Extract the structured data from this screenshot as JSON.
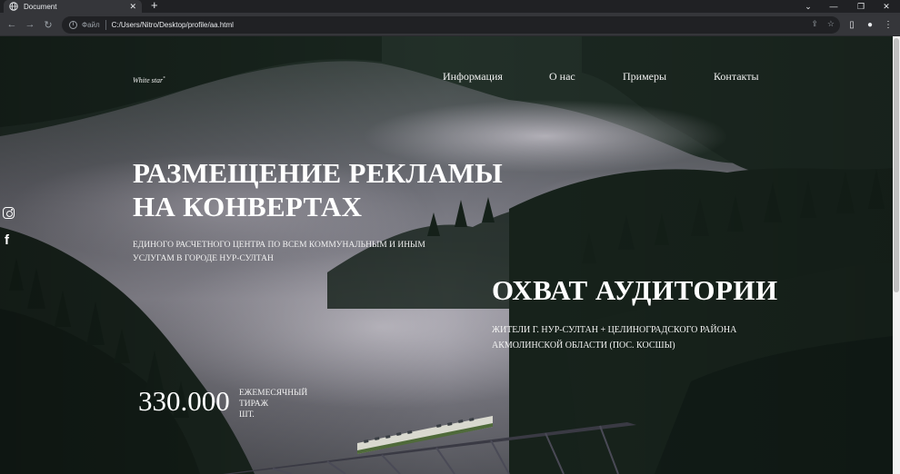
{
  "browser": {
    "tab_title": "Document",
    "url_scheme_label": "Файл",
    "url": "C:/Users/Nitro/Desktop/profile/aa.html"
  },
  "site": {
    "logo": "White star",
    "logo_mark": "*",
    "nav": [
      "Информация",
      "О нас",
      "Примеры",
      "Контакты"
    ],
    "headline_line1": "РАЗМЕЩЕНИЕ РЕКЛАМЫ",
    "headline_line2": "НА КОНВЕРТАХ",
    "sub_line1": "ЕДИНОГО РАСЧЕТНОГО ЦЕНТРА ПО ВСЕМ КОММУНАЛЬНЫМ И ИНЫМ",
    "sub_line2": "УСЛУГАМ В ГОРОДЕ НУР-СУЛТАН",
    "reach_title": "ОХВАТ АУДИТОРИИ",
    "reach_line1": "ЖИТЕЛИ Г. НУР-СУЛТАН + ЦЕЛИНОГРАДСКОГО РАЙОНА",
    "reach_line2": "АКМОЛИНСКОЙ ОБЛАСТИ (ПОС. КОСШЫ)",
    "stat_value": "330.000",
    "stat_label_line1": "ЕЖЕМЕСЯЧНЫЙ",
    "stat_label_line2": "ТИРАЖ",
    "stat_label_line3": "ШТ."
  },
  "icons": {
    "social": [
      "instagram-icon",
      "facebook-icon"
    ]
  }
}
